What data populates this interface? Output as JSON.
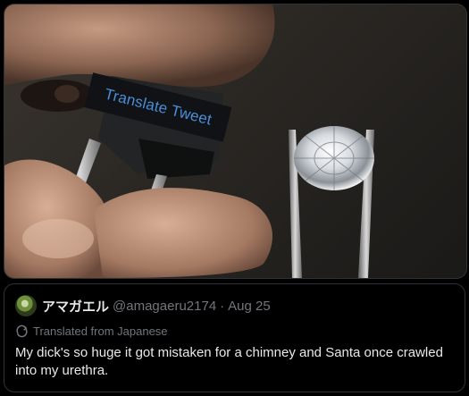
{
  "image_overlay": {
    "label": "Translate Tweet"
  },
  "quoted_tweet": {
    "display_name": "アマガエル",
    "handle": "@amagaeru2174",
    "separator": "·",
    "date": "Aug 25",
    "translated_label": "Translated from Japanese",
    "text": "My dick's so huge it got mistaken for a chimney and Santa once crawled into my urethra."
  },
  "colors": {
    "background": "#000000",
    "border": "#2f3336",
    "primary_text": "#e7e9ea",
    "secondary_text": "#71767b",
    "overlay_link": "#4a8fd8"
  },
  "icons": {
    "translate": "translate-icon"
  }
}
